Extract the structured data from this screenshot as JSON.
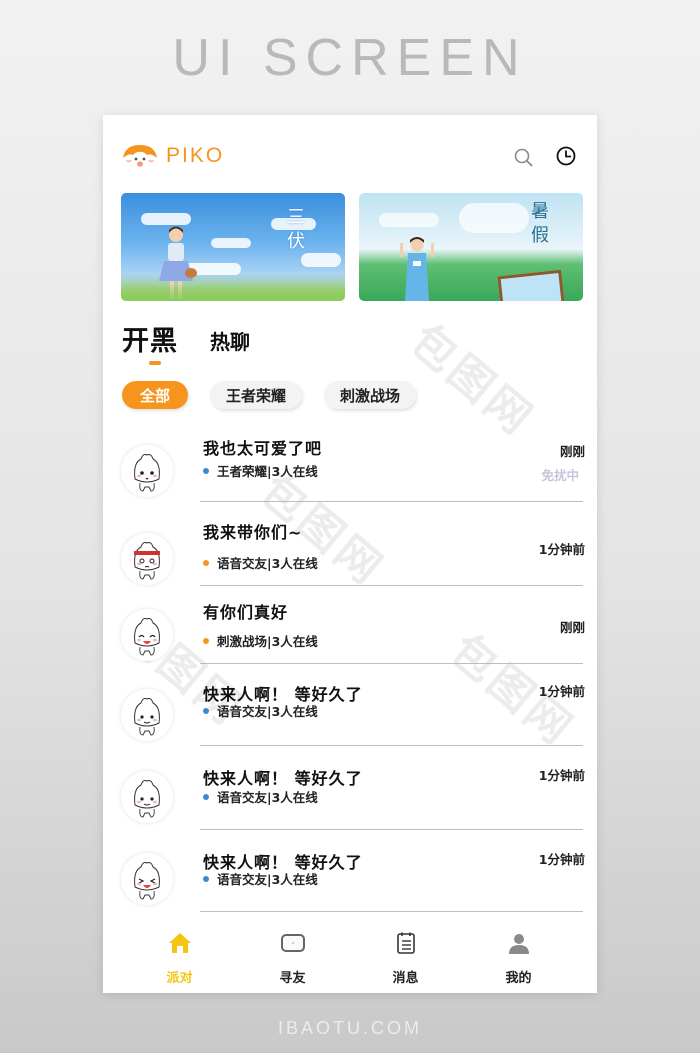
{
  "page_heading": "UI SCREEN",
  "footer_brand": "IBAOTU.COM",
  "header": {
    "logo_text": "PIKO",
    "search_icon": "search-icon",
    "history_icon": "clock-icon"
  },
  "banners": [
    {
      "title": "三伏",
      "alt": "girl on grassy field under blue sky"
    },
    {
      "title": "暑假",
      "alt": "girl waving on green hills with painting easel"
    }
  ],
  "main_tabs": [
    {
      "label": "开黑",
      "active": true
    },
    {
      "label": "热聊",
      "active": false
    }
  ],
  "chips": [
    {
      "label": "全部",
      "active": true
    },
    {
      "label": "王者荣耀",
      "active": false
    },
    {
      "label": "刺激战场",
      "active": false
    }
  ],
  "list": [
    {
      "title": "我也太可爱了吧",
      "category": "王者荣耀",
      "online": "3人在线",
      "meta": "王者荣耀|3人在线",
      "time": "刚刚",
      "status": "免扰中",
      "dot_color": "#3d86d6"
    },
    {
      "title": "我来带你们~",
      "category": "语音交友",
      "online": "3人在线",
      "meta": "语音交友|3人在线",
      "time": "1分钟前",
      "status": "",
      "dot_color": "#f7941d"
    },
    {
      "title": "有你们真好",
      "category": "刺激战场",
      "online": "3人在线",
      "meta": "刺激战场|3人在线",
      "time": "刚刚",
      "status": "",
      "dot_color": "#f7941d"
    },
    {
      "title": "快来人啊！ 等好久了",
      "category": "语音交友",
      "online": "3人在线",
      "meta": "语音交友|3人在线",
      "time": "1分钟前",
      "status": "",
      "dot_color": "#3d86d6"
    },
    {
      "title": "快来人啊！ 等好久了",
      "category": "语音交友",
      "online": "3人在线",
      "meta": "语音交友|3人在线",
      "time": "1分钟前",
      "status": "",
      "dot_color": "#3d86d6"
    },
    {
      "title": "快来人啊！ 等好久了",
      "category": "语音交友",
      "online": "3人在线",
      "meta": "语音交友|3人在线",
      "time": "1分钟前",
      "status": "",
      "dot_color": "#3d86d6"
    }
  ],
  "bottom_nav": [
    {
      "label": "派对",
      "icon": "home-icon",
      "active": true
    },
    {
      "label": "寻友",
      "icon": "screen-icon",
      "active": false
    },
    {
      "label": "消息",
      "icon": "list-icon",
      "active": false
    },
    {
      "label": "我的",
      "icon": "user-icon",
      "active": false
    }
  ],
  "colors": {
    "accent": "#f7941d",
    "nav_active": "#f6c511",
    "dot_blue": "#3d86d6",
    "status_muted": "#c9c3dc"
  }
}
